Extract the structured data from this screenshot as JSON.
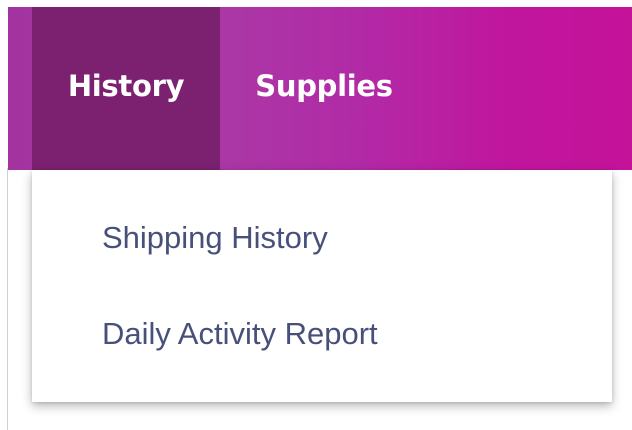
{
  "navbar": {
    "items": [
      {
        "label": "History",
        "active": true
      },
      {
        "label": "Supplies",
        "active": false
      }
    ],
    "colors": {
      "gradient_start": "#a3349f",
      "gradient_end": "#c41299",
      "active_tab": "#7b2170",
      "label": "#ffffff"
    }
  },
  "dropdown": {
    "items": [
      {
        "label": "Shipping History"
      },
      {
        "label": "Daily Activity Report"
      }
    ],
    "colors": {
      "background": "#ffffff",
      "text": "#47507a"
    }
  }
}
